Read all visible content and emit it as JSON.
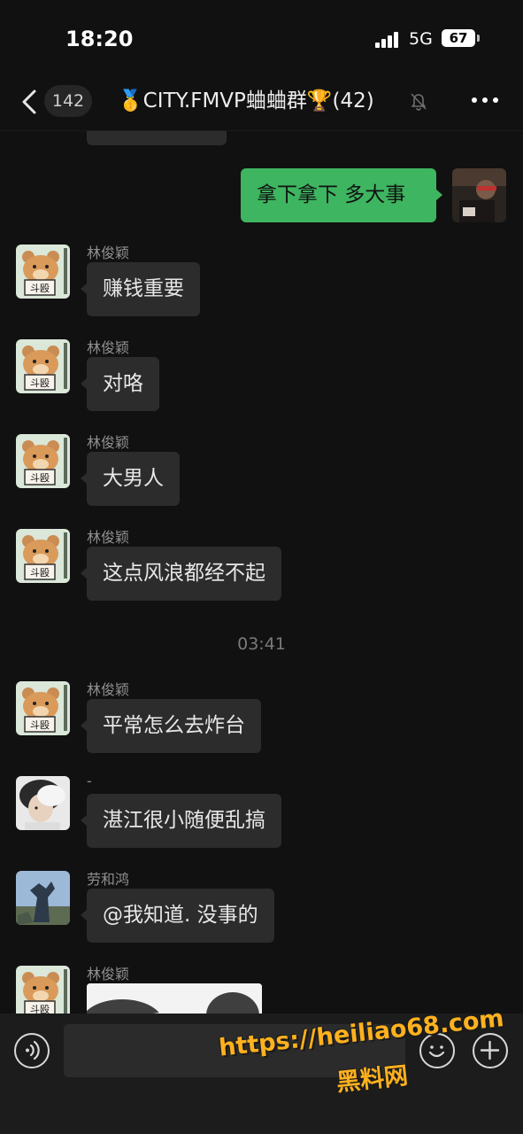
{
  "status_bar": {
    "time": "18:20",
    "network": "5G",
    "battery": "67"
  },
  "nav": {
    "unread_count": "142",
    "title": "🥇CITY.FMVP蛐蛐群🏆(42)",
    "back_icon": "chevron-left-icon",
    "mute_icon": "bell-muted-icon",
    "more_icon": "more-dots-icon"
  },
  "messages": [
    {
      "direction": "out",
      "text": "拿下拿下 多大事"
    },
    {
      "direction": "in",
      "sender": "林俊颖",
      "text": "赚钱重要"
    },
    {
      "direction": "in",
      "sender": "林俊颖",
      "text": "对咯"
    },
    {
      "direction": "in",
      "sender": "林俊颖",
      "text": "大男人"
    },
    {
      "direction": "in",
      "sender": "林俊颖",
      "text": "这点风浪都经不起"
    },
    {
      "direction": "in",
      "sender": "林俊颖",
      "text": "平常怎么去炸台"
    },
    {
      "direction": "in",
      "sender": "-",
      "text": "湛江很小随便乱搞"
    },
    {
      "direction": "in",
      "sender": "劳和鸿",
      "text": "@我知道. 没事的"
    },
    {
      "direction": "in",
      "sender": "林俊颖",
      "type": "image"
    }
  ],
  "timestamp": "03:41",
  "input_bar": {
    "placeholder": "",
    "voice_icon": "voice-icon",
    "emoji_icon": "emoji-icon",
    "plus_icon": "plus-icon"
  },
  "watermark": {
    "url": "https://heiliao68.com",
    "name": "黑料网"
  },
  "colors": {
    "background": "#111111",
    "bubble_in": "#2c2c2c",
    "bubble_out": "#3eb560",
    "watermark": "#ffb11e"
  }
}
